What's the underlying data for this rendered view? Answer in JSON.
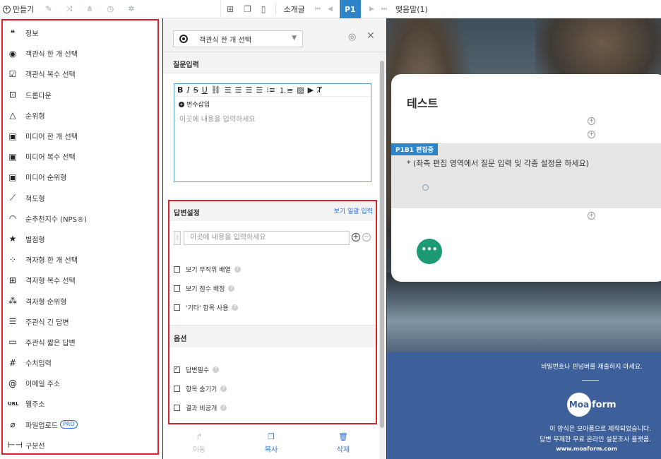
{
  "toolbar": {
    "make_label": "만들기",
    "left_icons": [
      "pin-icon",
      "shuffle-icon",
      "branch-icon",
      "clock-icon",
      "gear-icon"
    ],
    "intro_label": "소개글",
    "current_page": "P1",
    "ending_label": "맺음말(1)"
  },
  "question_types": [
    {
      "icon": "quote-icon",
      "glyph": "❝",
      "label": "정보"
    },
    {
      "icon": "radio-icon",
      "glyph": "◉",
      "label": "객관식 한 개 선택"
    },
    {
      "icon": "checkbox-icon",
      "glyph": "☑",
      "label": "객관식 복수 선택"
    },
    {
      "icon": "dropdown-icon",
      "glyph": "⊡",
      "label": "드롭다운"
    },
    {
      "icon": "triangle-icon",
      "glyph": "△",
      "label": "순위형"
    },
    {
      "icon": "media-single-icon",
      "glyph": "▣",
      "label": "미디어 한 개 선택"
    },
    {
      "icon": "media-multi-icon",
      "glyph": "▣",
      "label": "미디어 복수 선택"
    },
    {
      "icon": "media-rank-icon",
      "glyph": "▣",
      "label": "미디어 순위형"
    },
    {
      "icon": "ruler-icon",
      "glyph": "⟋",
      "label": "척도형"
    },
    {
      "icon": "gauge-icon",
      "glyph": "◠",
      "label": "순추천지수 (NPS®)"
    },
    {
      "icon": "star-icon",
      "glyph": "★",
      "label": "별점형"
    },
    {
      "icon": "grid-single-icon",
      "glyph": "⁘",
      "label": "격자형 한 개 선택"
    },
    {
      "icon": "grid-multi-icon",
      "glyph": "⊞",
      "label": "격자형 복수 선택"
    },
    {
      "icon": "grid-rank-icon",
      "glyph": "⁂",
      "label": "격자형 순위형"
    },
    {
      "icon": "long-text-icon",
      "glyph": "☰",
      "label": "주관식 긴 답변"
    },
    {
      "icon": "short-text-icon",
      "glyph": "▭",
      "label": "주관식 짧은 답변"
    },
    {
      "icon": "hash-icon",
      "glyph": "#",
      "label": "수치입력"
    },
    {
      "icon": "at-icon",
      "glyph": "@",
      "label": "이메일 주소"
    },
    {
      "icon": "url-icon",
      "glyph": "URL",
      "label": "웹주소"
    },
    {
      "icon": "paperclip-icon",
      "glyph": "⌀",
      "label": "파일업로드",
      "badge": "PRO"
    },
    {
      "icon": "divider-icon",
      "glyph": "⊢⊣",
      "label": "구분선"
    }
  ],
  "editor": {
    "type_select": "객관식 한 개 선택",
    "question_section": "질문입력",
    "var_insert": "변수삽입",
    "question_placeholder": "이곳에 내용을 입력하세요",
    "answer_section": "답변설정",
    "bulk_link": "보기 일괄 입력",
    "option_placeholder": "이곳에 내용을 입력하세요",
    "answer_checks": [
      {
        "label": "보기 무작위 배열",
        "checked": false
      },
      {
        "label": "보기 점수 배정",
        "checked": false
      },
      {
        "label": "'기타' 항목 사용",
        "checked": false
      }
    ],
    "options_section": "옵션",
    "option_checks": [
      {
        "label": "답변필수",
        "checked": true
      },
      {
        "label": "항목 숨기기",
        "checked": false
      },
      {
        "label": "결과 비공개",
        "checked": false
      }
    ],
    "footer": {
      "move": "이동",
      "copy": "복사",
      "delete": "삭제"
    }
  },
  "preview": {
    "title": "테스트",
    "badge": "P1B1 편집중",
    "question_text": "* (좌측 편집 영역에서 질문 입력 및 각종 설정을 하세요)",
    "more_label": "•••",
    "footer_warning": "비밀번호나 핀넘버를 제출하지 마세요.",
    "logo_a": "Moa",
    "logo_b": "form",
    "footer_line1": "이 양식은 모아폼으로 제작되었습니다.",
    "footer_line2": "답변 무제한 무료 온라인 설문조사 플랫폼.",
    "footer_url": "www.moaform.com"
  }
}
